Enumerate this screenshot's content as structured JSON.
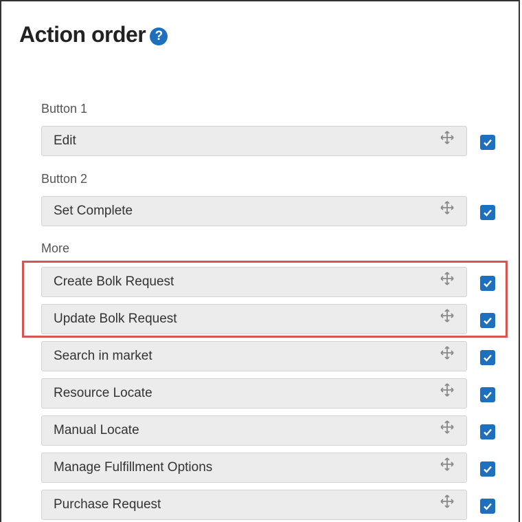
{
  "header": {
    "title": "Action order",
    "help_glyph": "?"
  },
  "sections": {
    "button1": "Button 1",
    "button2": "Button 2",
    "more": "More"
  },
  "actions": [
    {
      "label": "Edit",
      "checked": true
    },
    {
      "label": "Set Complete",
      "checked": true
    },
    {
      "label": "Create Bolk Request",
      "checked": true,
      "highlighted": true
    },
    {
      "label": "Update Bolk Request",
      "checked": true,
      "highlighted": true
    },
    {
      "label": "Search in market",
      "checked": true
    },
    {
      "label": "Resource Locate",
      "checked": true
    },
    {
      "label": "Manual Locate",
      "checked": true
    },
    {
      "label": "Manage Fulfillment Options",
      "checked": true
    },
    {
      "label": "Purchase Request",
      "checked": true
    }
  ],
  "icons": {
    "drag": "drag-handle-icon",
    "check": "checkbox-checked-icon",
    "help": "help-icon"
  },
  "colors": {
    "accent": "#1f6fbf",
    "highlight_border": "#d9534f",
    "row_background": "#ececec"
  }
}
